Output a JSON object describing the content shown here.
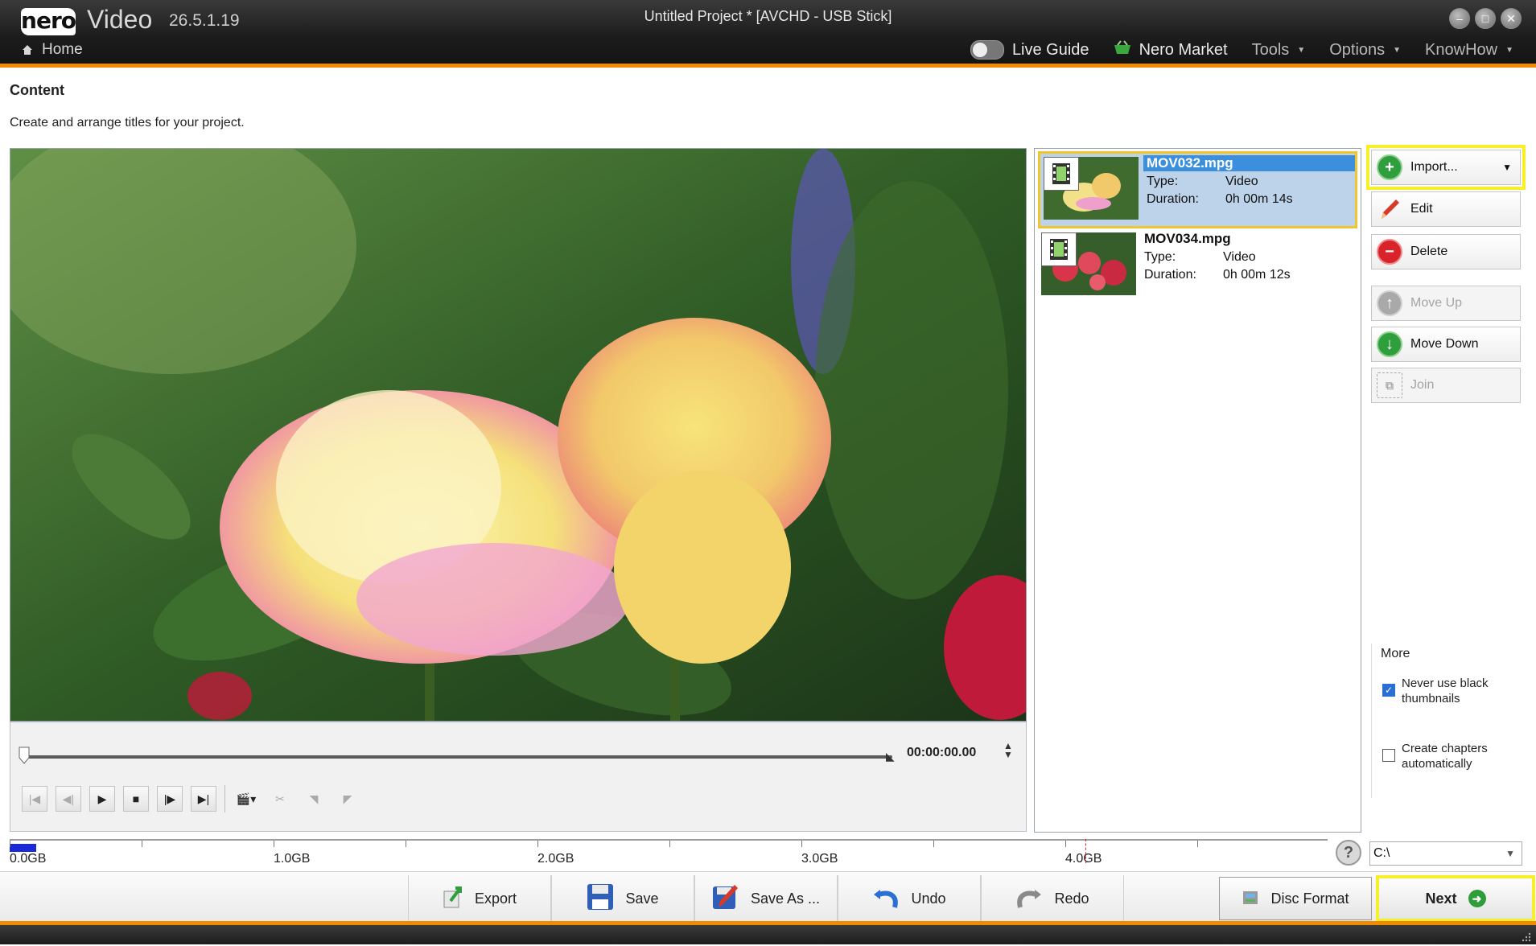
{
  "app": {
    "logo_text": "nero",
    "name": "Video",
    "version": "26.5.1.19",
    "window_title": "Untitled Project * [AVCHD - USB Stick]",
    "home_label": "Home",
    "accent_color": "#f08a00"
  },
  "topnav": {
    "live_guide": "Live Guide",
    "nero_market": "Nero Market",
    "tools": "Tools",
    "options": "Options",
    "knowhow": "KnowHow"
  },
  "content": {
    "title": "Content",
    "subtitle": "Create and arrange titles for your project."
  },
  "player": {
    "timecode": "00:00:00.00"
  },
  "files": [
    {
      "name": "MOV032.mpg",
      "type_label": "Type:",
      "type": "Video",
      "duration_label": "Duration:",
      "duration": "0h 00m 14s",
      "selected": true
    },
    {
      "name": "MOV034.mpg",
      "type_label": "Type:",
      "type": "Video",
      "duration_label": "Duration:",
      "duration": "0h 00m 12s",
      "selected": false
    }
  ],
  "actions": {
    "import": "Import...",
    "edit": "Edit",
    "delete": "Delete",
    "move_up": "Move Up",
    "move_down": "Move Down",
    "join": "Join"
  },
  "more": {
    "label": "More",
    "never_black_thumbs": "Never use black thumbnails",
    "never_black_thumbs_checked": true,
    "create_chapters": "Create chapters automatically",
    "create_chapters_checked": false
  },
  "capacity": {
    "labels": [
      "0.0GB",
      "1.0GB",
      "2.0GB",
      "3.0GB",
      "4.0GB"
    ],
    "used_fraction": 0.02,
    "drive": "C:\\"
  },
  "toolbar": {
    "export": "Export",
    "save": "Save",
    "save_as": "Save As ...",
    "undo": "Undo",
    "redo": "Redo",
    "disc_format": "Disc Format",
    "next": "Next"
  }
}
